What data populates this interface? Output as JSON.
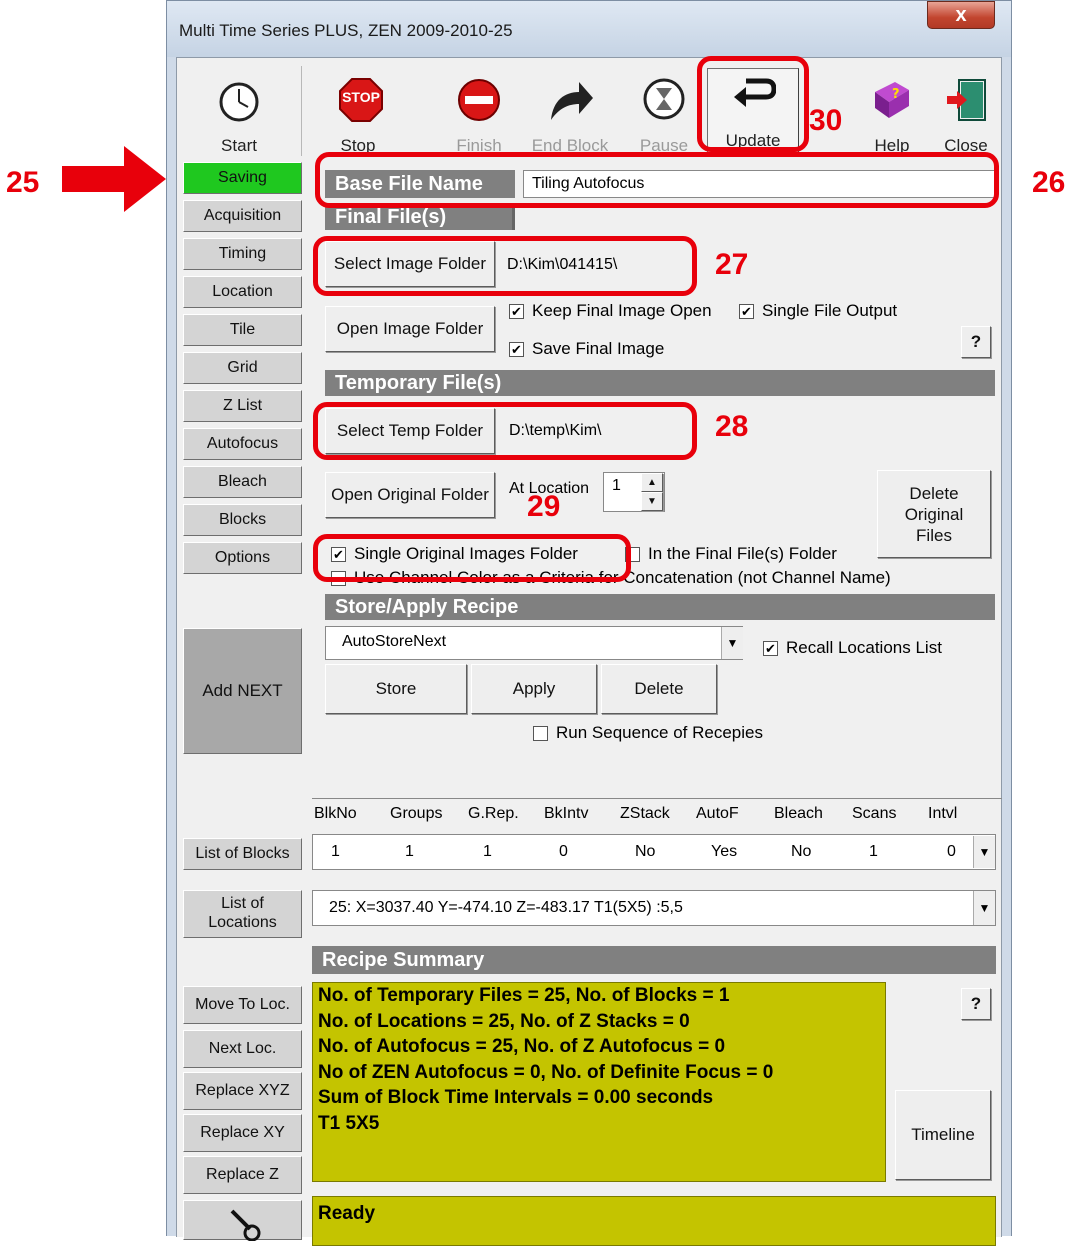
{
  "window": {
    "title": "Multi Time Series PLUS, ZEN 2009-2010-25",
    "close": "x"
  },
  "toolbar": {
    "start": "Start",
    "stop": "Stop",
    "stop_sign": "STOP",
    "finish": "Finish",
    "end_block": "End Block",
    "pause": "Pause",
    "update": "Update",
    "help": "Help",
    "close": "Close"
  },
  "sidebar": {
    "items": [
      "Saving",
      "Acquisition",
      "Timing",
      "Location",
      "Tile",
      "Grid",
      "Z List",
      "Autofocus",
      "Bleach",
      "Blocks",
      "Options"
    ],
    "active": "Saving",
    "add_next": "Add NEXT",
    "list_of_blocks": "List of Blocks",
    "list_of_locations_1": "List of",
    "list_of_locations_2": "Locations",
    "move_to_loc": "Move To Loc.",
    "next_loc": "Next Loc.",
    "replace_xyz": "Replace XYZ",
    "replace_xy": "Replace XY",
    "replace_z": "Replace Z"
  },
  "base_file": {
    "label": "Base File Name",
    "value": "Tiling Autofocus"
  },
  "final_files": {
    "header": "Final File(s)",
    "select_image_folder": "Select Image Folder",
    "image_folder": "D:\\Kim\\041415\\",
    "open_image_folder": "Open Image Folder",
    "keep_final_open": "Keep Final Image Open",
    "single_file_output": "Single File Output",
    "save_final_image": "Save Final Image",
    "help_q": "?"
  },
  "temp_files": {
    "header": "Temporary File(s)",
    "select_temp_folder": "Select Temp Folder",
    "temp_folder": "D:\\temp\\Kim\\",
    "open_original_folder": "Open Original Folder",
    "at_location_label": "At Location",
    "at_location_value": "1",
    "delete_original_1": "Delete",
    "delete_original_2": "Original",
    "delete_original_3": "Files",
    "single_original_folder": "Single Original Images Folder",
    "in_final_folder": "In the Final File(s) Folder",
    "use_channel_color": "Use Channel Color as a Criteria for Concatenation (not Channel Name)"
  },
  "recipe": {
    "header": "Store/Apply Recipe",
    "selected": "AutoStoreNext",
    "recall_locations": "Recall Locations List",
    "store": "Store",
    "apply": "Apply",
    "delete": "Delete",
    "run_sequence": "Run Sequence of Recepies"
  },
  "blocks_table": {
    "headers": [
      "BlkNo",
      "Groups",
      "G.Rep.",
      "BkIntv",
      "ZStack",
      "AutoF",
      "Bleach",
      "Scans",
      "Intvl"
    ],
    "row": [
      "1",
      "1",
      "1",
      "0",
      "No",
      "Yes",
      "No",
      "1",
      "0"
    ]
  },
  "locations": {
    "selected": "25: X=3037.40 Y=-474.10 Z=-483.17   T1(5X5) :5,5"
  },
  "summary": {
    "header": "Recipe Summary",
    "lines": [
      "No. of Temporary Files = 25, No. of Blocks = 1",
      "No. of Locations = 25, No. of Z Stacks = 0",
      "No. of Autofocus = 25, No. of Z Autofocus = 0",
      "No of ZEN Autofocus = 0, No. of Definite Focus = 0",
      "Sum of  Block Time Intervals = 0.00 seconds",
      "T1 5X5"
    ],
    "help_q": "?",
    "timeline": "Timeline"
  },
  "status": {
    "text": "Ready"
  },
  "annotations": {
    "n25": "25",
    "n26": "26",
    "n27": "27",
    "n28": "28",
    "n29": "29",
    "n30": "30"
  },
  "colors": {
    "active_tab": "#1fc81f",
    "summary_bg": "#c4c400",
    "annotation": "#e8000b",
    "section_header": "#808080"
  }
}
